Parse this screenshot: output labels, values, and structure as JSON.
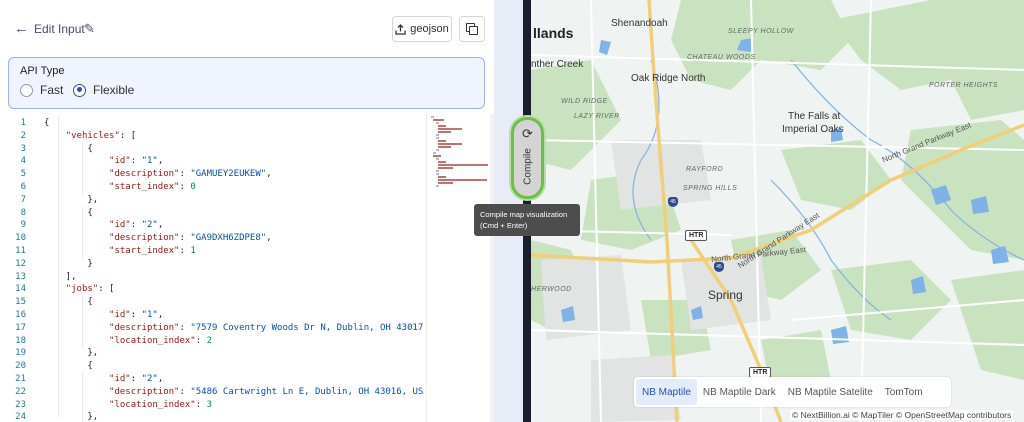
{
  "header": {
    "back_icon": "arrow-left-icon",
    "title": "Edit Input",
    "edit_icon": "pencil-icon",
    "geojson_label": "geojson",
    "upload_icon": "upload-icon",
    "copy_icon": "copy-icon"
  },
  "api_type": {
    "title": "API Type",
    "options": [
      {
        "label": "Fast",
        "checked": false
      },
      {
        "label": "Flexible",
        "checked": true
      }
    ]
  },
  "editor": {
    "line_numbers": [
      "1",
      "2",
      "3",
      "4",
      "5",
      "6",
      "7",
      "8",
      "9",
      "10",
      "11",
      "12",
      "13",
      "14",
      "15",
      "16",
      "17",
      "18",
      "19",
      "20",
      "21",
      "22",
      "23",
      "24"
    ],
    "lines": [
      "{",
      "    \"vehicles\": [",
      "        {",
      "            \"id\": \"1\",",
      "            \"description\": \"GAMUEY2EUKEW\",",
      "            \"start_index\": 0",
      "        },",
      "        {",
      "            \"id\": \"2\",",
      "            \"description\": \"GA9DXH6ZDPE8\",",
      "            \"start_index\": 1",
      "        }",
      "    ],",
      "    \"jobs\": [",
      "        {",
      "            \"id\": \"1\",",
      "            \"description\": \"7579 Coventry Woods Dr N, Dublin, OH 43017, US",
      "            \"location_index\": 2",
      "        },",
      "        {",
      "            \"id\": \"2\",",
      "            \"description\": \"5486 Cartwright Ln E, Dublin, OH 43016, USA\",",
      "            \"location_index\": 3",
      "        },"
    ]
  },
  "compile": {
    "label": "Compile",
    "icon": "refresh-icon",
    "tooltip_line1": "Compile map visualization",
    "tooltip_line2": "(Cmd + Enter)"
  },
  "map": {
    "labels": {
      "woodlands": "llands",
      "shenandoah": "Shenandoah",
      "sleepy_hollow": "SLEEPY HOLLOW",
      "chateau_woods": "CHATEAU WOODS",
      "panther_creek": "nther Creek",
      "oak_ridge_north": "Oak Ridge North",
      "wild_ridge": "WILD RIDGE",
      "lazy_river": "LAZY RIVER",
      "porter_heights": "PORTER HEIGHTS",
      "falls_1": "The Falls at",
      "falls_2": "Imperial Oaks",
      "rayford": "RAYFORD",
      "spring_hills": "SPRING HILLS",
      "grand_parkway_east_1": "North Grand Parkway East",
      "grand_parkway_east_2": "North Grand Parkway East",
      "grand_parkway_east_3": "North Grand Parkway East",
      "herwood": "HERWOOD",
      "spring": "Spring"
    },
    "shields": {
      "i45_a": "45",
      "i45_b": "45",
      "htr_a": "HTR",
      "htr_b": "HTR"
    },
    "basemaps": [
      {
        "label": "NB Maptile",
        "active": true
      },
      {
        "label": "NB Maptile Dark",
        "active": false
      },
      {
        "label": "NB Maptile Satelite",
        "active": false
      },
      {
        "label": "TomTom",
        "active": false
      }
    ],
    "attribution": "© NextBillion.ai © MapTiler © OpenStreetMap contributors",
    "colors": {
      "land": "#eff3f1",
      "forest": "#c9e3c0",
      "water": "#7fb2e6",
      "highway": "#f0cf78",
      "road": "#ffffff"
    }
  }
}
